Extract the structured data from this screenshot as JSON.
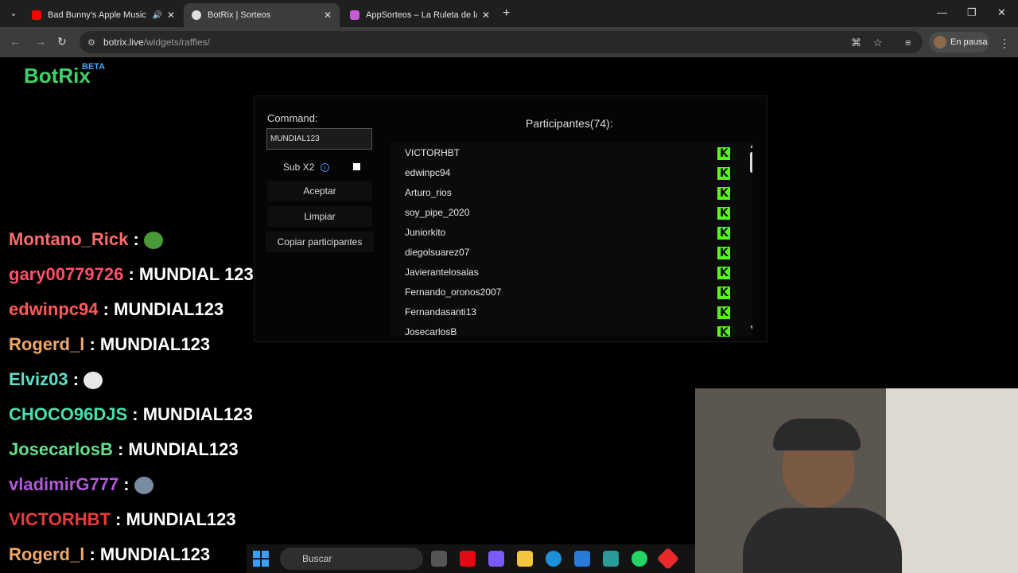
{
  "browser": {
    "tabs": [
      {
        "title": "Bad Bunny's Apple Music S",
        "favicon_color": "#ff0000",
        "active": false
      },
      {
        "title": "BotRix | Sorteos",
        "favicon_color": "#e0e0e0",
        "active": true
      },
      {
        "title": "AppSorteos – La Ruleta de la S",
        "favicon_color": "#c85ad8",
        "active": false
      }
    ],
    "url_host": "botrix.live",
    "url_path": "/widgets/raffles/",
    "profile_label": "En pausa"
  },
  "brand": {
    "logo": "BotRix",
    "badge": "BETA"
  },
  "raffle": {
    "command_label": "Command:",
    "command_value": "MUNDIAL123",
    "sub_label": "Sub X2",
    "info_glyph": "i",
    "buttons": {
      "accept": "Aceptar",
      "clear": "Limpiar",
      "copy": "Copiar participantes"
    },
    "participants_title": "Participantes(74):",
    "participants": [
      "VICTORHBT",
      "edwinpc94",
      "Arturo_rios",
      "soy_pipe_2020",
      "Juniorkito",
      "diegolsuarez07",
      "Javierantelosalas",
      "Fernando_oronos2007",
      "Fernandasanti13",
      "JosecarlosB"
    ]
  },
  "chat": [
    {
      "user": "Montano_Rick",
      "color": "#ff6b6b",
      "message": "",
      "emote": "pepe-emote",
      "emote_color": "#4a9a3a"
    },
    {
      "user": "gary00779726",
      "color": "#ff4f6a",
      "message": "MUNDIAL 123"
    },
    {
      "user": "edwinpc94",
      "color": "#ff5a5a",
      "message": "MUNDIAL123"
    },
    {
      "user": "Rogerd_l",
      "color": "#f0a868",
      "message": "MUNDIAL123"
    },
    {
      "user": "Elviz03",
      "color": "#5ee0c8",
      "message": "",
      "emote": "hand-emote",
      "emote_color": "#e8e8e8"
    },
    {
      "user": "CHOCO96DJS",
      "color": "#46e0b0",
      "message": "MUNDIAL123"
    },
    {
      "user": "JosecarlosB",
      "color": "#63e08a",
      "message": "MUNDIAL123"
    },
    {
      "user": "vladimirG777",
      "color": "#b05ad8",
      "message": "",
      "emote": "bird-emote",
      "emote_color": "#7a8aa0"
    },
    {
      "user": "VICTORHBT",
      "color": "#e83a3a",
      "message": "MUNDIAL123"
    },
    {
      "user": "Rogerd_l",
      "color": "#f0a868",
      "message": "MUNDIAL123"
    }
  ],
  "taskbar": {
    "search_label": "Buscar"
  }
}
